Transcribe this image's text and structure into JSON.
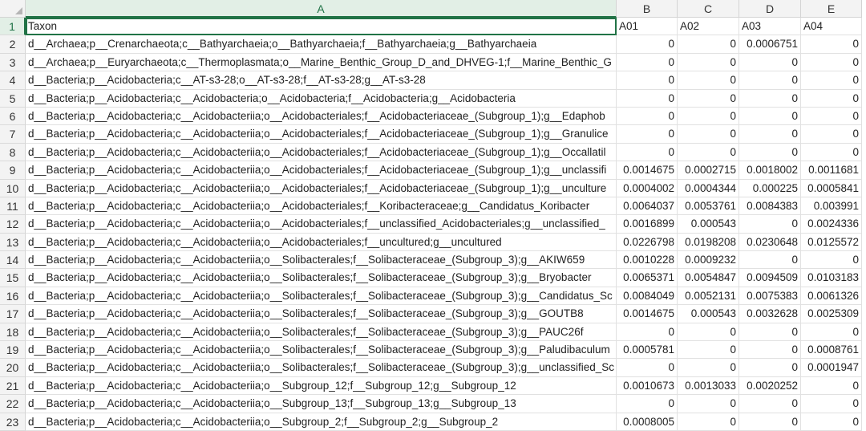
{
  "sheet": {
    "corner_icon": "select-all-triangle",
    "columns": [
      "A",
      "B",
      "C",
      "D",
      "E"
    ],
    "selected_column": "A",
    "active_cell": "A1",
    "rows": [
      [
        "Taxon",
        "A01",
        "A02",
        "A03",
        "A04"
      ],
      [
        "d__Archaea;p__Crenarchaeota;c__Bathyarchaeia;o__Bathyarchaeia;f__Bathyarchaeia;g__Bathyarchaeia",
        "0",
        "0",
        "0.0006751",
        "0"
      ],
      [
        "d__Archaea;p__Euryarchaeota;c__Thermoplasmata;o__Marine_Benthic_Group_D_and_DHVEG-1;f__Marine_Benthic_G",
        "0",
        "0",
        "0",
        "0"
      ],
      [
        "d__Bacteria;p__Acidobacteria;c__AT-s3-28;o__AT-s3-28;f__AT-s3-28;g__AT-s3-28",
        "0",
        "0",
        "0",
        "0"
      ],
      [
        "d__Bacteria;p__Acidobacteria;c__Acidobacteria;o__Acidobacteria;f__Acidobacteria;g__Acidobacteria",
        "0",
        "0",
        "0",
        "0"
      ],
      [
        "d__Bacteria;p__Acidobacteria;c__Acidobacteriia;o__Acidobacteriales;f__Acidobacteriaceae_(Subgroup_1);g__Edaphob",
        "0",
        "0",
        "0",
        "0"
      ],
      [
        "d__Bacteria;p__Acidobacteria;c__Acidobacteriia;o__Acidobacteriales;f__Acidobacteriaceae_(Subgroup_1);g__Granulice",
        "0",
        "0",
        "0",
        "0"
      ],
      [
        "d__Bacteria;p__Acidobacteria;c__Acidobacteriia;o__Acidobacteriales;f__Acidobacteriaceae_(Subgroup_1);g__Occallatil",
        "0",
        "0",
        "0",
        "0"
      ],
      [
        "d__Bacteria;p__Acidobacteria;c__Acidobacteriia;o__Acidobacteriales;f__Acidobacteriaceae_(Subgroup_1);g__unclassifi",
        "0.0014675",
        "0.0002715",
        "0.0018002",
        "0.0011681"
      ],
      [
        "d__Bacteria;p__Acidobacteria;c__Acidobacteriia;o__Acidobacteriales;f__Acidobacteriaceae_(Subgroup_1);g__unculture",
        "0.0004002",
        "0.0004344",
        "0.000225",
        "0.0005841"
      ],
      [
        "d__Bacteria;p__Acidobacteria;c__Acidobacteriia;o__Acidobacteriales;f__Koribacteraceae;g__Candidatus_Koribacter",
        "0.0064037",
        "0.0053761",
        "0.0084383",
        "0.003991"
      ],
      [
        "d__Bacteria;p__Acidobacteria;c__Acidobacteriia;o__Acidobacteriales;f__unclassified_Acidobacteriales;g__unclassified_",
        "0.0016899",
        "0.000543",
        "0",
        "0.0024336"
      ],
      [
        "d__Bacteria;p__Acidobacteria;c__Acidobacteriia;o__Acidobacteriales;f__uncultured;g__uncultured",
        "0.0226798",
        "0.0198208",
        "0.0230648",
        "0.0125572"
      ],
      [
        "d__Bacteria;p__Acidobacteria;c__Acidobacteriia;o__Solibacterales;f__Solibacteraceae_(Subgroup_3);g__AKIW659",
        "0.0010228",
        "0.0009232",
        "0",
        "0"
      ],
      [
        "d__Bacteria;p__Acidobacteria;c__Acidobacteriia;o__Solibacterales;f__Solibacteraceae_(Subgroup_3);g__Bryobacter",
        "0.0065371",
        "0.0054847",
        "0.0094509",
        "0.0103183"
      ],
      [
        "d__Bacteria;p__Acidobacteria;c__Acidobacteriia;o__Solibacterales;f__Solibacteraceae_(Subgroup_3);g__Candidatus_Sc",
        "0.0084049",
        "0.0052131",
        "0.0075383",
        "0.0061326"
      ],
      [
        "d__Bacteria;p__Acidobacteria;c__Acidobacteriia;o__Solibacterales;f__Solibacteraceae_(Subgroup_3);g__GOUTB8",
        "0.0014675",
        "0.000543",
        "0.0032628",
        "0.0025309"
      ],
      [
        "d__Bacteria;p__Acidobacteria;c__Acidobacteriia;o__Solibacterales;f__Solibacteraceae_(Subgroup_3);g__PAUC26f",
        "0",
        "0",
        "0",
        "0"
      ],
      [
        "d__Bacteria;p__Acidobacteria;c__Acidobacteriia;o__Solibacterales;f__Solibacteraceae_(Subgroup_3);g__Paludibaculum",
        "0.0005781",
        "0",
        "0",
        "0.0008761"
      ],
      [
        "d__Bacteria;p__Acidobacteria;c__Acidobacteriia;o__Solibacterales;f__Solibacteraceae_(Subgroup_3);g__unclassified_Sc",
        "0",
        "0",
        "0",
        "0.0001947"
      ],
      [
        "d__Bacteria;p__Acidobacteria;c__Acidobacteriia;o__Subgroup_12;f__Subgroup_12;g__Subgroup_12",
        "0.0010673",
        "0.0013033",
        "0.0020252",
        "0"
      ],
      [
        "d__Bacteria;p__Acidobacteria;c__Acidobacteriia;o__Subgroup_13;f__Subgroup_13;g__Subgroup_13",
        "0",
        "0",
        "0",
        "0"
      ],
      [
        "d__Bacteria;p__Acidobacteria;c__Acidobacteriia;o__Subgroup_2;f__Subgroup_2;g__Subgroup_2",
        "0.0008005",
        "0",
        "0",
        "0"
      ]
    ]
  }
}
